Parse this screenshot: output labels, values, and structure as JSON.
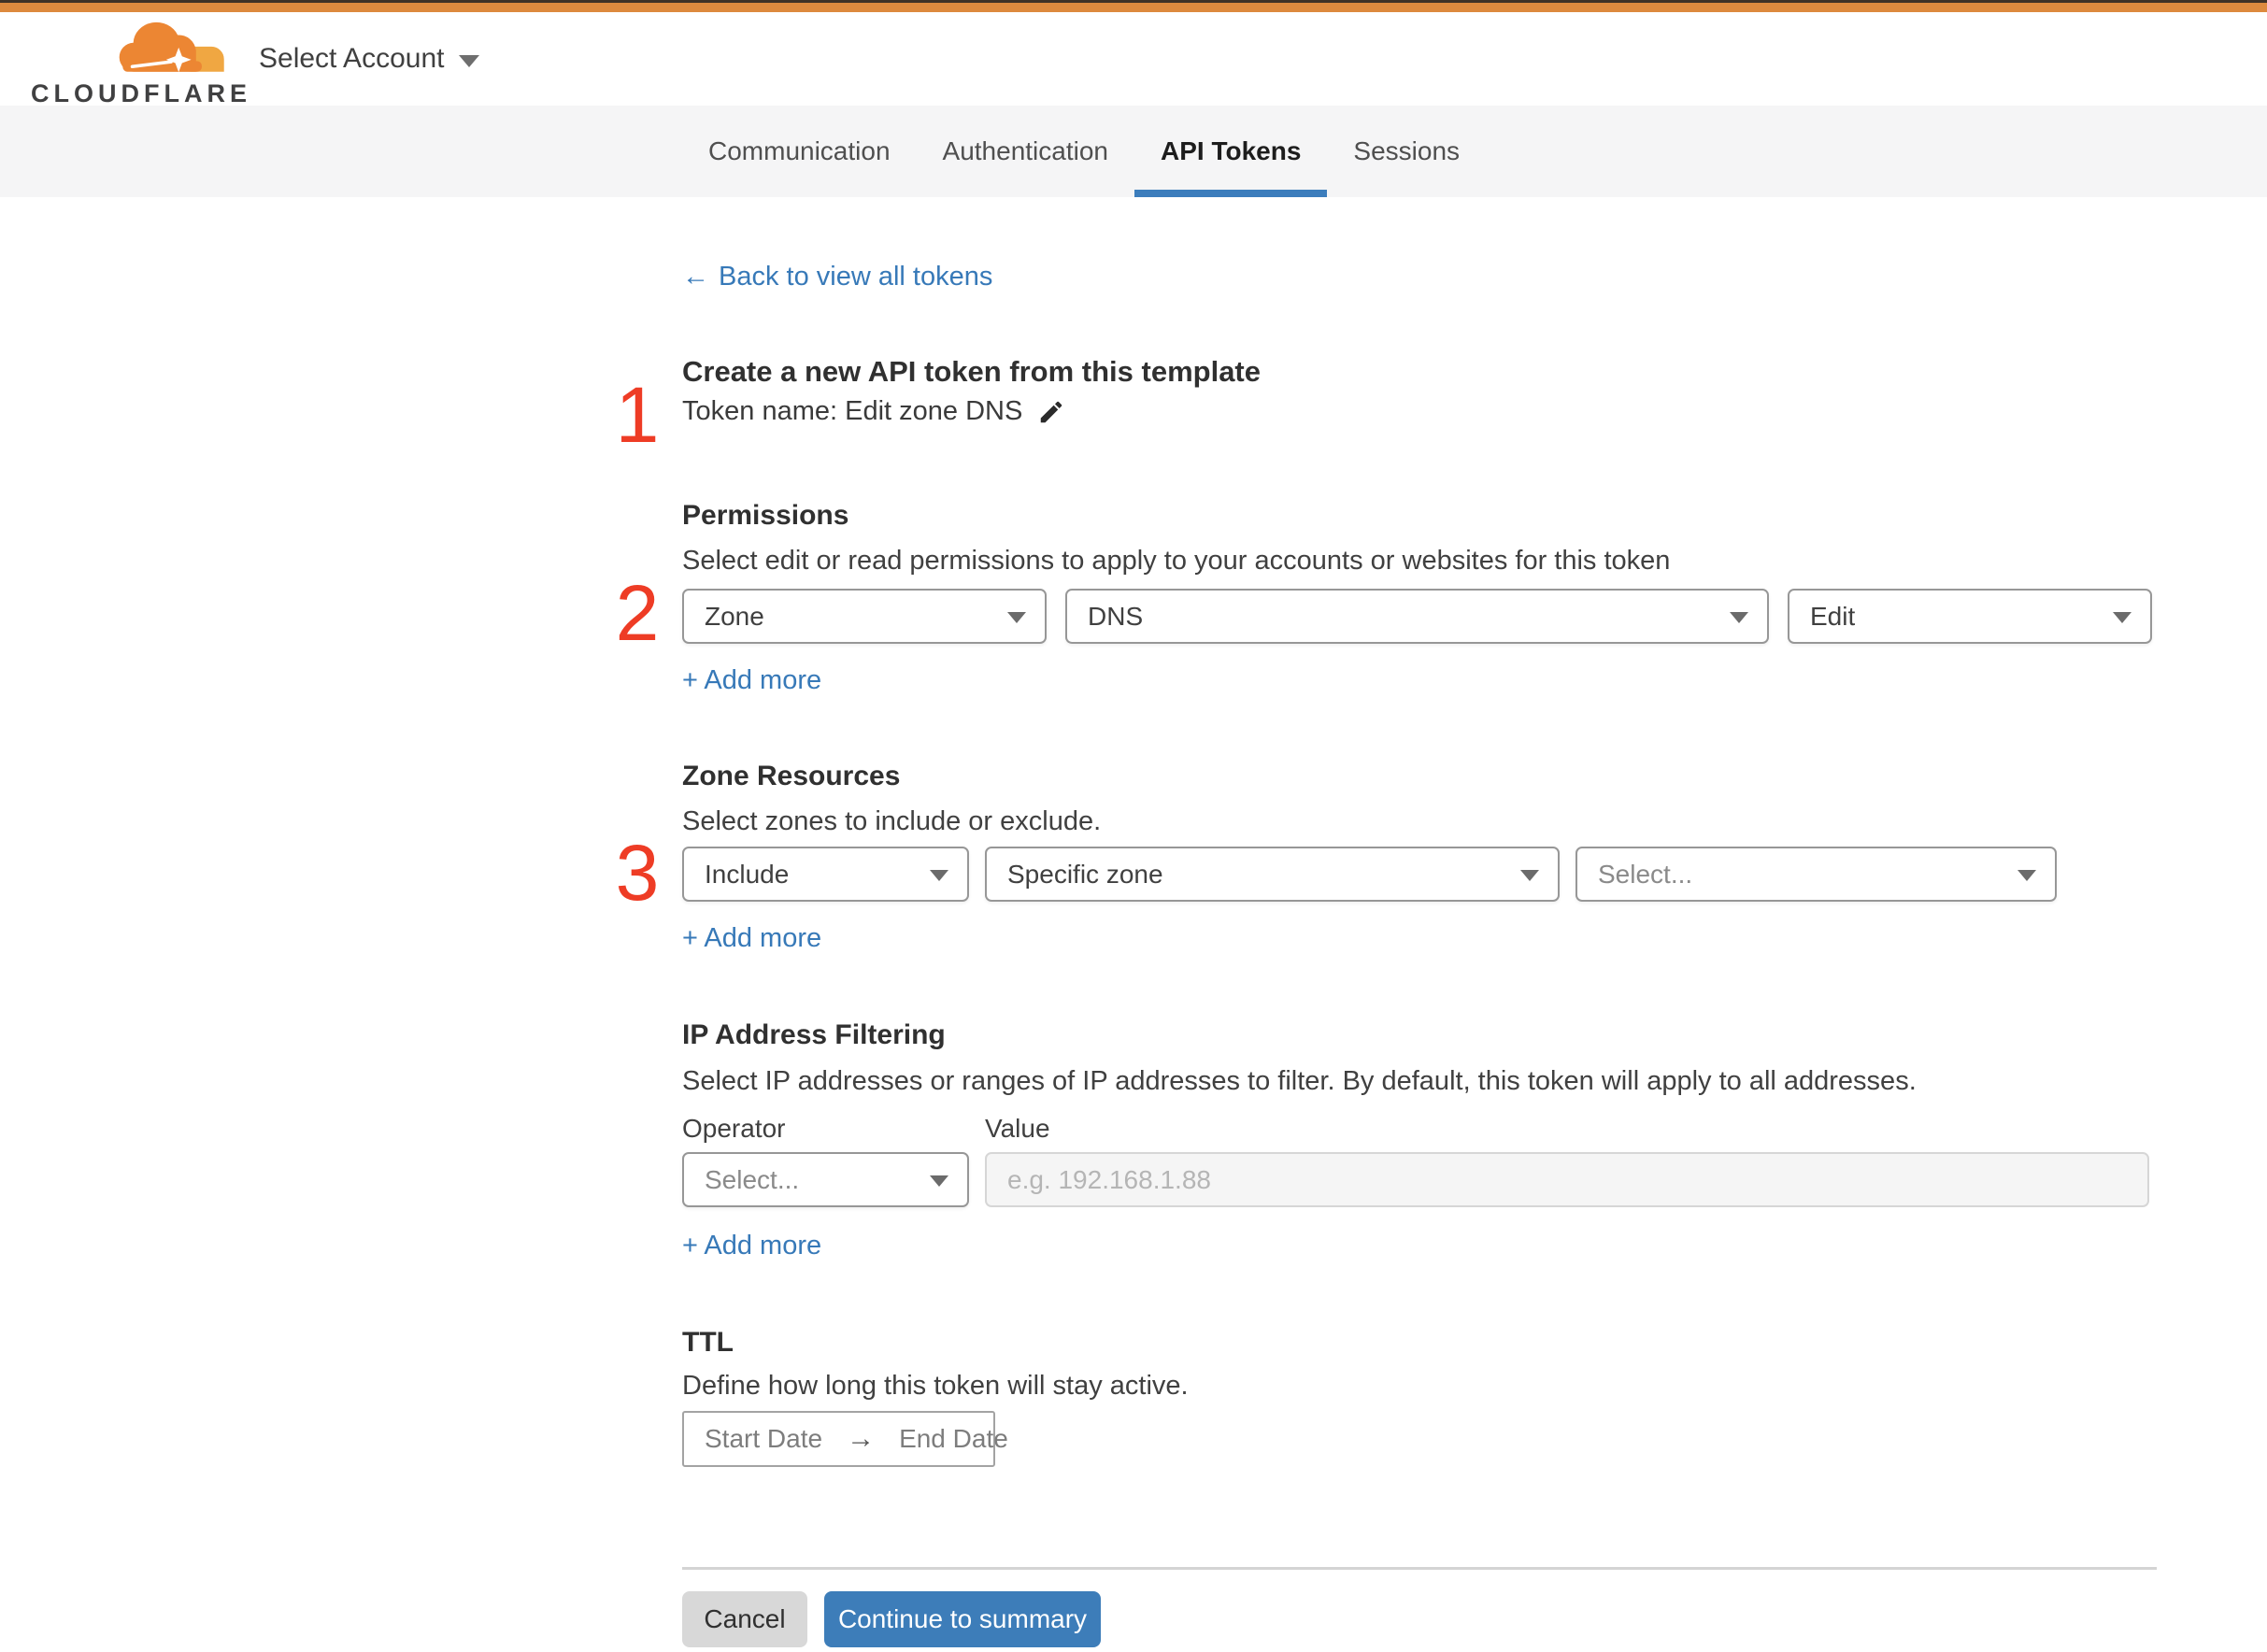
{
  "header": {
    "logo_text": "CLOUDFLARE",
    "account_selector_label": "Select Account"
  },
  "tabs": [
    {
      "label": "Communication",
      "active": false
    },
    {
      "label": "Authentication",
      "active": false
    },
    {
      "label": "API Tokens",
      "active": true
    },
    {
      "label": "Sessions",
      "active": false
    }
  ],
  "back_link": {
    "arrow": "←",
    "label": "Back to view all tokens"
  },
  "steps": {
    "one": "1",
    "two": "2",
    "three": "3"
  },
  "token_template": {
    "heading": "Create a new API token from this template",
    "token_name_line": "Token name: Edit zone DNS"
  },
  "permissions": {
    "heading": "Permissions",
    "description": "Select edit or read permissions to apply to your accounts or websites for this token",
    "scope_value": "Zone",
    "resource_value": "DNS",
    "access_value": "Edit",
    "add_more_label": "+ Add more"
  },
  "zone_resources": {
    "heading": "Zone Resources",
    "description": "Select zones to include or exclude.",
    "mode_value": "Include",
    "type_value": "Specific zone",
    "zone_placeholder": "Select...",
    "add_more_label": "+ Add more"
  },
  "ip_filtering": {
    "heading": "IP Address Filtering",
    "description": "Select IP addresses or ranges of IP addresses to filter. By default, this token will apply to all addresses.",
    "operator_label": "Operator",
    "value_label": "Value",
    "operator_placeholder": "Select...",
    "value_placeholder": "e.g. 192.168.1.88",
    "add_more_label": "+ Add more"
  },
  "ttl": {
    "heading": "TTL",
    "description": "Define how long this token will stay active.",
    "start_label": "Start Date",
    "arrow": "→",
    "end_label": "End Date"
  },
  "footer": {
    "cancel_label": "Cancel",
    "continue_label": "Continue to summary"
  },
  "colors": {
    "brand_orange": "#dd8a3e",
    "step_number_red": "#ee3c25",
    "accent_blue": "#3d7db9",
    "tab_underline_blue": "#3c7dbc"
  }
}
